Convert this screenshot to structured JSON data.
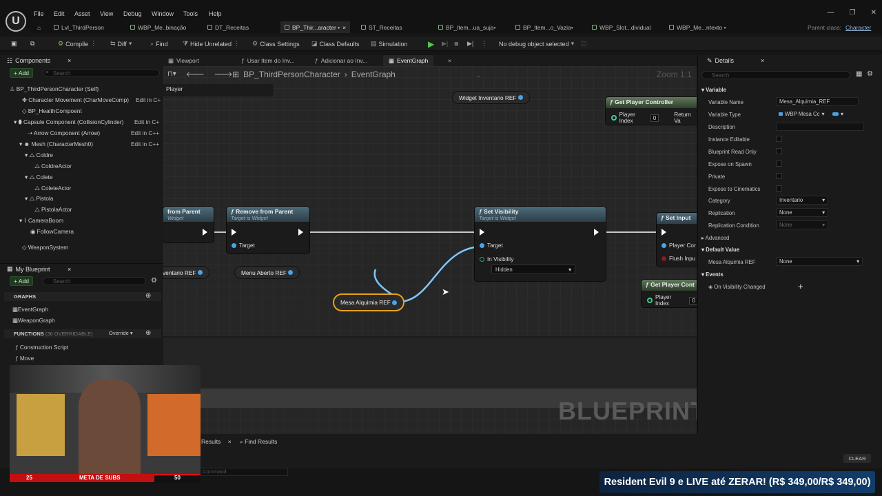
{
  "menu": [
    "File",
    "Edit",
    "Asset",
    "View",
    "Debug",
    "Window",
    "Tools",
    "Help"
  ],
  "doc_tabs": [
    {
      "label": "Lvl_ThirdPerson"
    },
    {
      "label": "WBP_Me..binação"
    },
    {
      "label": "DT_Receitas"
    },
    {
      "label": "BP_Thir...aracter •",
      "close": "×"
    },
    {
      "label": "ST_Receitas"
    },
    {
      "label": "BP_Item...ua_suja•"
    },
    {
      "label": "BP_Item...o_Vazia•"
    },
    {
      "label": "WBP_Slot...dividual"
    },
    {
      "label": "WBP_Me...ntexto •"
    }
  ],
  "parent_class_label": "Parent class:",
  "parent_class_value": "Character",
  "toolbar": {
    "compile": "Compile",
    "diff": "Diff",
    "find": "Find",
    "hide_unrelated": "Hide Unrelated",
    "class_settings": "Class Settings",
    "class_defaults": "Class Defaults",
    "simulation": "Simulation",
    "debug_object": "No debug object selected"
  },
  "components": {
    "title": "Components",
    "add": "Add",
    "search_placeholder": "Search",
    "root": "BP_ThirdPersonCharacter (Self)",
    "items": [
      {
        "label": "Character Movement (CharMoveComp)",
        "edit": "Edit in C+"
      },
      {
        "label": "BP_HealthCompoent",
        "edit": ""
      },
      {
        "label": "Capsule Component (CollisionCylinder)",
        "edit": "Edit in C+"
      },
      {
        "label": "Arrow Component (Arrow)",
        "edit": "Edit in C++"
      },
      {
        "label": "Mesh (CharacterMesh0)",
        "edit": "Edit in C++"
      },
      {
        "label": "Coldre",
        "edit": ""
      },
      {
        "label": "ColdreActor",
        "edit": ""
      },
      {
        "label": "Colete",
        "edit": ""
      },
      {
        "label": "ColeteActor",
        "edit": ""
      },
      {
        "label": "Pistola",
        "edit": ""
      },
      {
        "label": "PistolaActor",
        "edit": ""
      },
      {
        "label": "CameraBoom",
        "edit": ""
      },
      {
        "label": "FollowCamera",
        "edit": ""
      },
      {
        "label": "WeaponSystem",
        "edit": ""
      }
    ]
  },
  "my_blueprint": {
    "title": "My Blueprint",
    "add": "Add",
    "search_placeholder": "Search",
    "graphs_label": "GRAPHS",
    "graphs": [
      "EventGraph",
      "WeaponGraph"
    ],
    "functions_label": "FUNCTIONS",
    "functions_count": "(36 OVERRIDABLE)",
    "override": "Override",
    "functions": [
      "Construction Script",
      "Move"
    ]
  },
  "graph_tabs": [
    "Viewport",
    "Usar Item do Inv...",
    "Adicionar ao Inv...",
    "EventGraph"
  ],
  "breadcrumb": {
    "class": "BP_ThirdPersonCharacter",
    "graph": "EventGraph",
    "zoom": "Zoom 1:1"
  },
  "nodes": {
    "get_player_controller": {
      "title": "Get Player Controller",
      "pin": "Player Index",
      "value": "0",
      "ret": "Return Va"
    },
    "get_player_controller2": {
      "title": "Get Player Cont",
      "pin": "Player Index",
      "value": "0"
    },
    "remove_from_parent_left": {
      "title": "from Parent",
      "sub": "Widget"
    },
    "remove_from_parent": {
      "title": "Remove from Parent",
      "sub": "Target is Widget",
      "pin": "Target"
    },
    "set_visibility": {
      "title": "Set Visibility",
      "sub": "Target is Widget",
      "pin_target": "Target",
      "pin_vis": "In Visibility",
      "vis_value": "Hidden"
    },
    "set_input": {
      "title": "Set Input",
      "pin": "Player Cor",
      "pin2": "Flush Inpu"
    },
    "player_label": "Player"
  },
  "variables": {
    "widget_inventario": "Widget Inventario REF",
    "inventario_left": "ventario REF",
    "menu_aberto": "Menu Aberto REF",
    "mesa_alquimia": "Mesa Alquimia REF"
  },
  "watermark": "BLUEPRINT",
  "details": {
    "title": "Details",
    "search_placeholder": "Search",
    "section_variable": "Variable",
    "rows": [
      {
        "label": "Variable Name",
        "value": "Mesa_Alquimia_REF"
      },
      {
        "label": "Variable Type",
        "value": "WBP Mesa Cc"
      },
      {
        "label": "Description",
        "value": ""
      },
      {
        "label": "Instance Editable"
      },
      {
        "label": "Blueprint Read Only"
      },
      {
        "label": "Expose on Spawn"
      },
      {
        "label": "Private"
      },
      {
        "label": "Expose to Cinematics"
      },
      {
        "label": "Category",
        "value": "Inventario"
      },
      {
        "label": "Replication",
        "value": "None"
      },
      {
        "label": "Replication Condition",
        "value": "None"
      }
    ],
    "advanced": "Advanced",
    "section_default": "Default Value",
    "default_label": "Mesa Alquimia REF",
    "default_value": "None",
    "section_events": "Events",
    "event_label": "On Visibility Changed"
  },
  "bottom": {
    "results": "Results",
    "find_results": "Find Results",
    "command_placeholder": "Command",
    "clear": "CLEAR"
  },
  "stream": {
    "subs_min": "25",
    "subs_label": "META DE SUBS",
    "subs_max": "50",
    "promo": "Resident Evil 9 e LIVE até ZERAR! (R$ 349,00/R$ 349,00)"
  },
  "colors": {
    "accent": "#4aa3e6",
    "selected_node": "#e7a21a",
    "promo": "#123d6b",
    "subs": "#c21010"
  }
}
